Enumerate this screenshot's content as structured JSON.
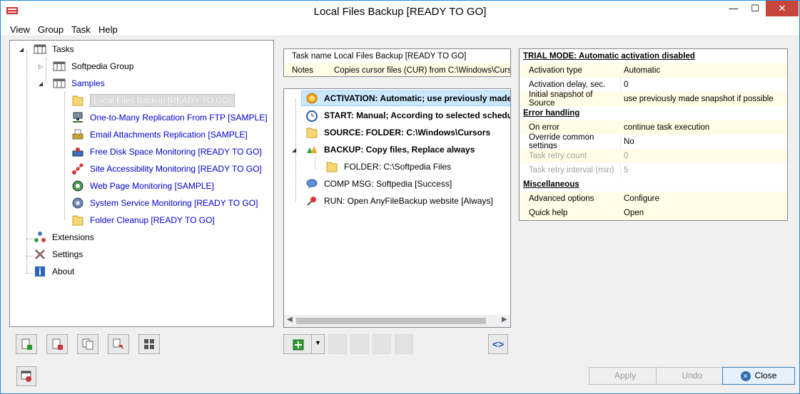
{
  "window": {
    "title": "Local Files Backup [READY TO GO]",
    "controls": {
      "minimize": "—",
      "maximize": "☐",
      "close": "✕"
    }
  },
  "menu": [
    "View",
    "Group",
    "Task",
    "Help"
  ],
  "tree": {
    "root": "Tasks",
    "softpedia_group": "Softpedia Group",
    "samples": "Samples",
    "items": [
      {
        "label": "Local Files Backup [READY TO GO]",
        "icon": "folder-icon",
        "selected": true
      },
      {
        "label": "One-to-Many Replication From FTP [SAMPLE]",
        "icon": "network-icon"
      },
      {
        "label": "Email Attachments Replication [SAMPLE]",
        "icon": "printer-icon"
      },
      {
        "label": "Free Disk Space Monitoring [READY TO GO]",
        "icon": "disk-icon"
      },
      {
        "label": "Site Accessibility Monitoring [READY TO GO]",
        "icon": "nodes-icon"
      },
      {
        "label": "Web Page Monitoring [SAMPLE]",
        "icon": "globe-icon"
      },
      {
        "label": "System Service Monitoring [READY TO GO]",
        "icon": "gear-icon"
      },
      {
        "label": "Folder Cleanup [READY TO GO]",
        "icon": "folder-icon"
      }
    ],
    "extensions": "Extensions",
    "settings": "Settings",
    "about": "About"
  },
  "task_info": {
    "name_key": "Task name",
    "name_value": "Local Files Backup [READY TO GO]",
    "notes_key": "Notes",
    "notes_value": "Copies cursor files (CUR) from C:\\Windows\\Cursors"
  },
  "steps": [
    {
      "label": "ACTIVATION: Automatic; use previously made snapshot",
      "bold": true,
      "icon": "sun-icon"
    },
    {
      "label": "START: Manual; According to selected schedule",
      "bold": true,
      "icon": "clock-icon"
    },
    {
      "label": "SOURCE: FOLDER: C:\\Windows\\Cursors",
      "bold": true,
      "icon": "folder-icon"
    },
    {
      "label": "BACKUP: Copy files, Replace always",
      "bold": true,
      "icon": "backup-icon"
    },
    {
      "label": "FOLDER: C:\\Softpedia Files",
      "bold": false,
      "icon": "folder-icon"
    },
    {
      "label": "COMP MSG: Softpedia [Success]",
      "bold": false,
      "icon": "message-icon"
    },
    {
      "label": "RUN: Open AnyFileBackup website [Always]",
      "bold": false,
      "icon": "pin-icon"
    }
  ],
  "properties": {
    "trial_header": "TRIAL MODE: Automatic activation disabled",
    "rows1": [
      {
        "key": "Activation type",
        "value": "Automatic"
      },
      {
        "key": "Activation delay, sec.",
        "value": "0"
      },
      {
        "key": "Initial snapshot of Source",
        "value": "use previously made snapshot if possible"
      }
    ],
    "error_header": "Error handling",
    "rows2": [
      {
        "key": "On error",
        "value": "continue task execution"
      },
      {
        "key": "Override common settings",
        "value": "No"
      },
      {
        "key": "Task retry count",
        "value": "0"
      },
      {
        "key": "Task retry interval (min)",
        "value": "5"
      }
    ],
    "misc_header": "Miscellaneous",
    "rows3": [
      {
        "key": "Advanced options",
        "value": "Configure"
      },
      {
        "key": "Quick help",
        "value": "Open"
      }
    ]
  },
  "buttons": {
    "apply": "Apply",
    "undo": "Undo",
    "close": "Close",
    "code": "<>"
  }
}
